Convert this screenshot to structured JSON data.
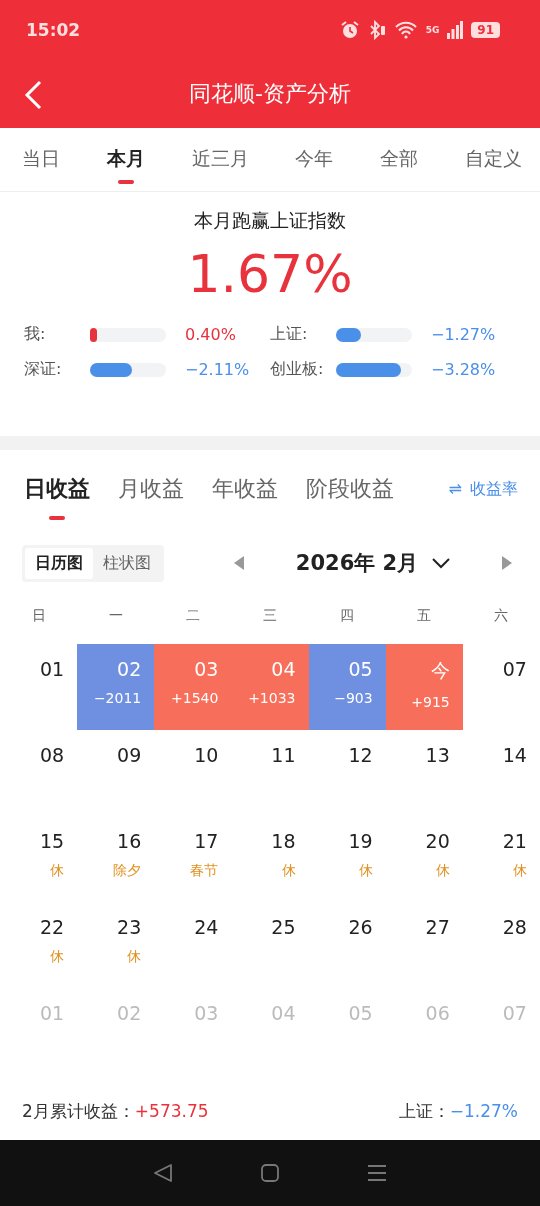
{
  "status_bar": {
    "time": "15:02",
    "network": "5G",
    "battery": "91"
  },
  "header": {
    "title": "同花顺-资产分析"
  },
  "period_tabs": [
    {
      "label": "当日",
      "selected": false
    },
    {
      "label": "本月",
      "selected": true
    },
    {
      "label": "近三月",
      "selected": false
    },
    {
      "label": "今年",
      "selected": false
    },
    {
      "label": "全部",
      "selected": false
    },
    {
      "label": "自定义",
      "selected": false
    }
  ],
  "summary": {
    "title": "本月跑赢上证指数",
    "value": "1.67%"
  },
  "comparisons": [
    {
      "name": "我:",
      "level": 0.04,
      "reading": "0.40%",
      "color": "#e8323c"
    },
    {
      "name": "上证:",
      "level": 0.33,
      "reading": "−1.27%",
      "color": "#4a8fe8"
    },
    {
      "name": "深证:",
      "level": 0.55,
      "reading": "−2.11%",
      "color": "#4a8fe8"
    },
    {
      "name": "创业板:",
      "level": 0.85,
      "reading": "−3.28%",
      "color": "#4a8fe8"
    }
  ],
  "income_tabs": [
    {
      "label": "日收益",
      "selected": true
    },
    {
      "label": "月收益",
      "selected": false
    },
    {
      "label": "年收益",
      "selected": false
    },
    {
      "label": "阶段收益",
      "selected": false
    }
  ],
  "rate_link": {
    "icon": "⇌",
    "label": "收益率"
  },
  "view_toggle": [
    {
      "label": "日历图",
      "selected": true
    },
    {
      "label": "柱状图",
      "selected": false
    }
  ],
  "month_label": "2026年 2月",
  "weekdays": [
    "日",
    "一",
    "二",
    "三",
    "四",
    "五",
    "六"
  ],
  "weeks": [
    [
      {
        "day": "01",
        "kind": "plain"
      },
      {
        "day": "02",
        "kind": "loss",
        "amount": "−2011"
      },
      {
        "day": "03",
        "kind": "gain",
        "amount": "+1540"
      },
      {
        "day": "04",
        "kind": "gain",
        "amount": "+1033"
      },
      {
        "day": "05",
        "kind": "loss",
        "amount": "−903"
      },
      {
        "day": "今",
        "kind": "gain",
        "amount": "+915"
      },
      {
        "day": "07",
        "kind": "plain"
      }
    ],
    [
      {
        "day": "08",
        "kind": "plain"
      },
      {
        "day": "09",
        "kind": "plain"
      },
      {
        "day": "10",
        "kind": "plain"
      },
      {
        "day": "11",
        "kind": "plain"
      },
      {
        "day": "12",
        "kind": "plain"
      },
      {
        "day": "13",
        "kind": "plain"
      },
      {
        "day": "14",
        "kind": "plain"
      }
    ],
    [
      {
        "day": "15",
        "kind": "plain",
        "note": "休"
      },
      {
        "day": "16",
        "kind": "plain",
        "note": "除夕"
      },
      {
        "day": "17",
        "kind": "plain",
        "note": "春节"
      },
      {
        "day": "18",
        "kind": "plain",
        "note": "休"
      },
      {
        "day": "19",
        "kind": "plain",
        "note": "休"
      },
      {
        "day": "20",
        "kind": "plain",
        "note": "休"
      },
      {
        "day": "21",
        "kind": "plain",
        "note": "休"
      }
    ],
    [
      {
        "day": "22",
        "kind": "plain",
        "note": "休"
      },
      {
        "day": "23",
        "kind": "plain",
        "note": "休"
      },
      {
        "day": "24",
        "kind": "plain"
      },
      {
        "day": "25",
        "kind": "plain"
      },
      {
        "day": "26",
        "kind": "plain"
      },
      {
        "day": "27",
        "kind": "plain"
      },
      {
        "day": "28",
        "kind": "plain"
      }
    ],
    [
      {
        "day": "01",
        "kind": "other"
      },
      {
        "day": "02",
        "kind": "other"
      },
      {
        "day": "03",
        "kind": "other"
      },
      {
        "day": "04",
        "kind": "other"
      },
      {
        "day": "05",
        "kind": "other"
      },
      {
        "day": "06",
        "kind": "other"
      },
      {
        "day": "07",
        "kind": "other"
      }
    ]
  ],
  "footer": {
    "total_label": "2月累计收益：",
    "total_value": "+573.75",
    "index_label": "上证：",
    "index_value": "−1.27%"
  }
}
